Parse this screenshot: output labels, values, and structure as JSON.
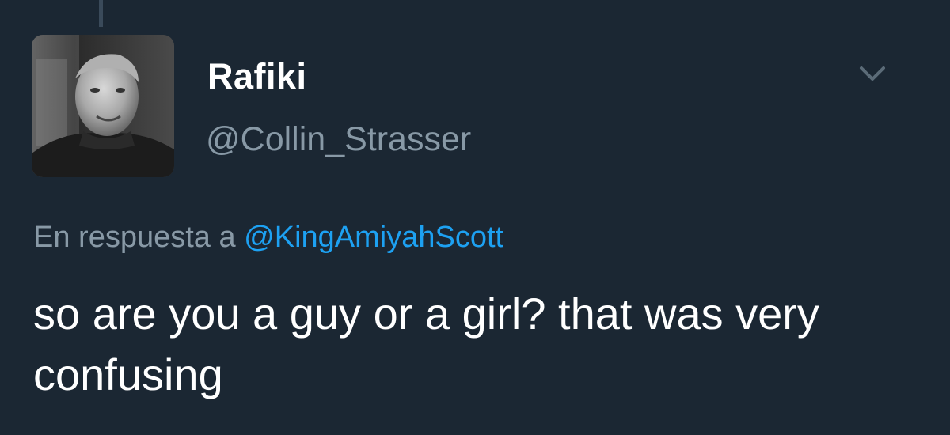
{
  "tweet": {
    "author": {
      "display_name": "Rafiki",
      "handle": "@Collin_Strasser",
      "avatar_icon": "user-photo-avatar"
    },
    "menu_icon": "chevron-down-icon",
    "reply_prefix": "En respuesta a",
    "reply_to": "@KingAmiyahScott",
    "text": "so are you a guy or a girl? that was very confusing"
  },
  "colors": {
    "background": "#1b2733",
    "text_primary": "#ffffff",
    "text_secondary": "#8899a6",
    "link": "#1da1f2",
    "thread_line": "#3a4a5a"
  }
}
